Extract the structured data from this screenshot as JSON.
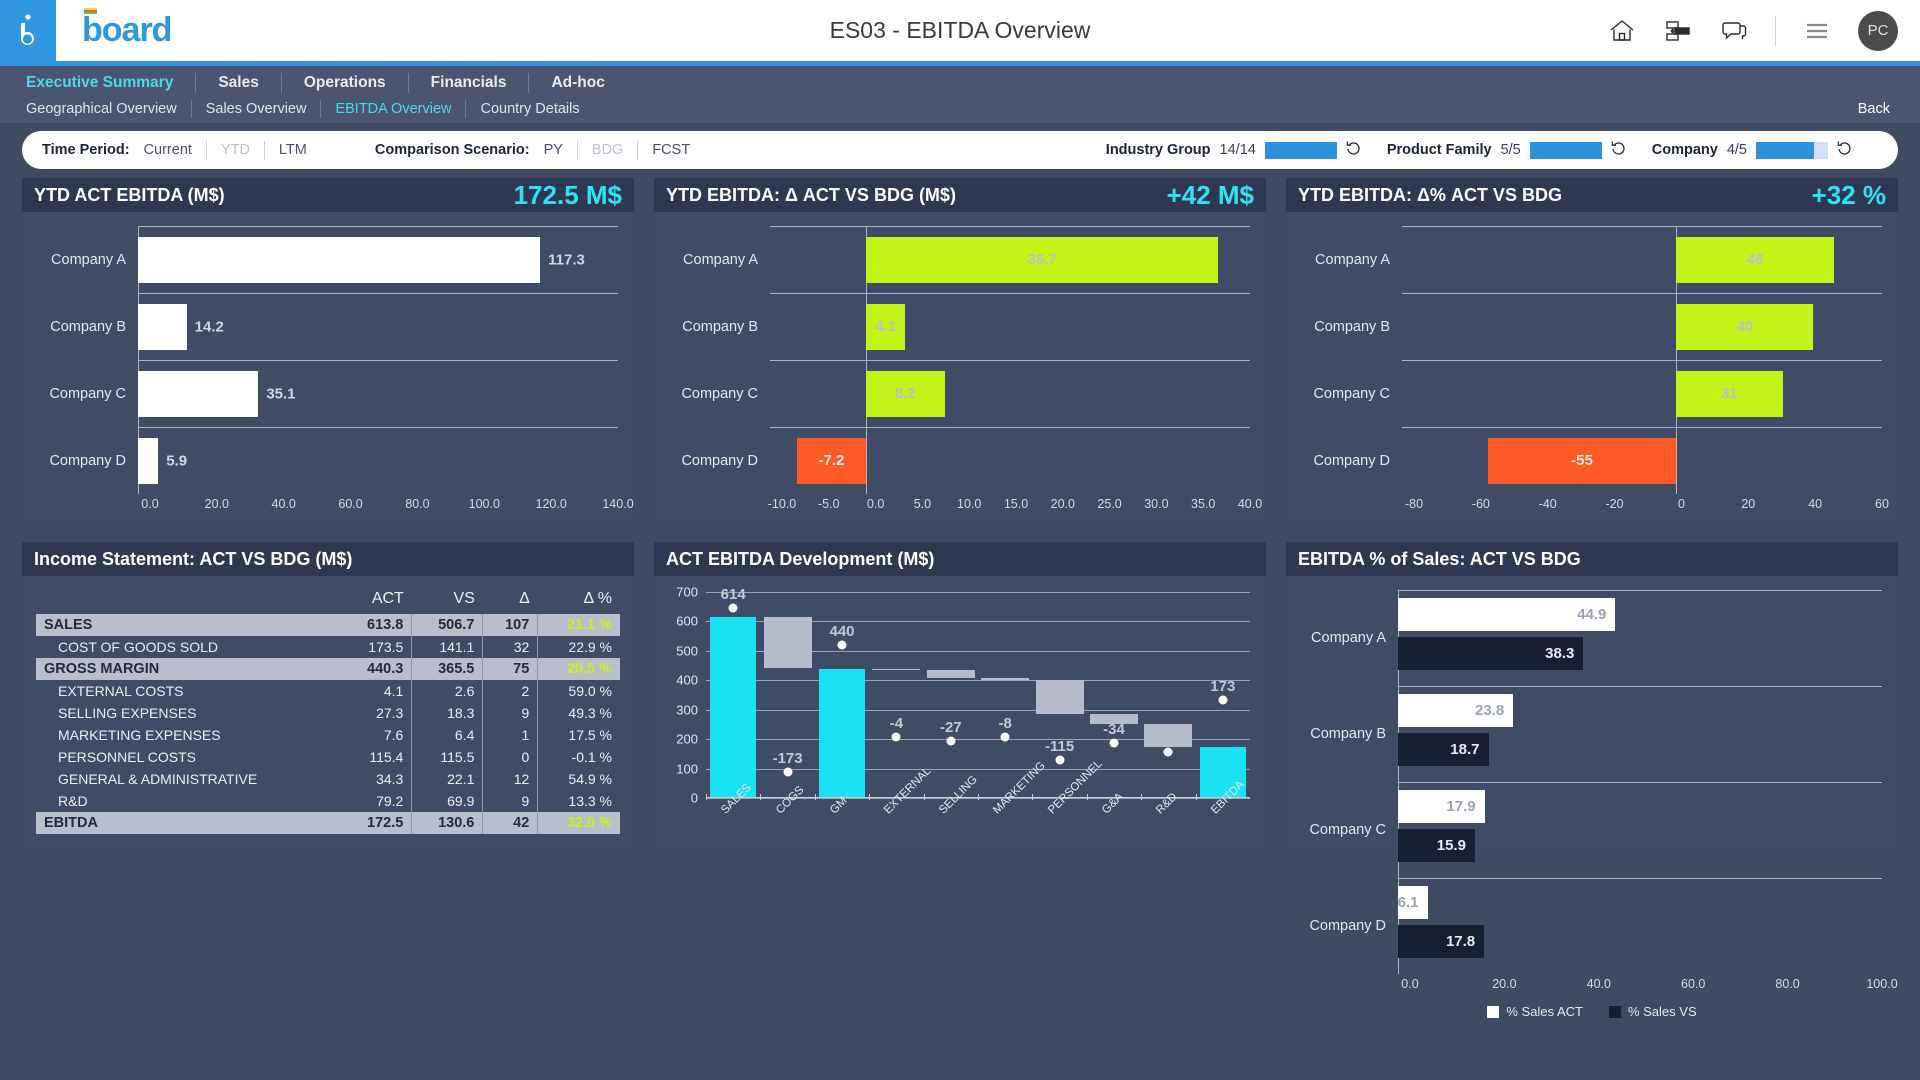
{
  "header": {
    "title": "ES03 - EBITDA Overview",
    "logo_text": "board",
    "icons": [
      "home-icon",
      "layout-icon",
      "chat-icon",
      "hamburger-icon"
    ],
    "avatar_initials": "PC"
  },
  "nav": {
    "level1": [
      {
        "label": "Executive Summary",
        "active": true
      },
      {
        "label": "Sales",
        "active": false
      },
      {
        "label": "Operations",
        "active": false
      },
      {
        "label": "Financials",
        "active": false
      },
      {
        "label": "Ad-hoc",
        "active": false
      }
    ],
    "level2": [
      {
        "label": "Geographical Overview",
        "active": false
      },
      {
        "label": "Sales Overview",
        "active": false
      },
      {
        "label": "EBITDA Overview",
        "active": true
      },
      {
        "label": "Country Details",
        "active": false
      }
    ],
    "back_label": "Back"
  },
  "filters": {
    "time_period_label": "Time Period:",
    "time_period_options": [
      {
        "label": "Current",
        "selected": true
      },
      {
        "label": "YTD",
        "selected": false
      },
      {
        "label": "LTM",
        "selected": true
      }
    ],
    "comparison_label": "Comparison Scenario:",
    "comparison_options": [
      {
        "label": "PY",
        "selected": true
      },
      {
        "label": "BDG",
        "selected": false
      },
      {
        "label": "FCST",
        "selected": true
      }
    ],
    "selectors": [
      {
        "name": "Industry Group",
        "count": "14/14",
        "fill_pct": 100
      },
      {
        "name": "Product Family",
        "count": "5/5",
        "fill_pct": 100
      },
      {
        "name": "Company",
        "count": "4/5",
        "fill_pct": 80
      }
    ]
  },
  "chart_data": [
    {
      "id": "ytd_act_ebitda",
      "type": "bar",
      "orientation": "horizontal",
      "title": "YTD ACT EBITDA (M$)",
      "kpi": "172.5 M$",
      "categories": [
        "Company A",
        "Company B",
        "Company C",
        "Company D"
      ],
      "values": [
        117.3,
        14.2,
        35.1,
        5.9
      ],
      "labels": [
        "117.3",
        "14.2",
        "35.1",
        "5.9"
      ],
      "bar_color": "#ffffff",
      "xlim": [
        0,
        140
      ],
      "ticks": [
        "0.0",
        "20.0",
        "40.0",
        "60.0",
        "80.0",
        "100.0",
        "120.0",
        "140.0"
      ],
      "tick_values": [
        0,
        20,
        40,
        60,
        80,
        100,
        120,
        140
      ],
      "grid": true
    },
    {
      "id": "ytd_ebitda_delta_act_vs_bdg",
      "type": "bar",
      "orientation": "horizontal",
      "title": "YTD EBITDA: Δ ACT VS BDG (M$)",
      "kpi": "+42 M$",
      "categories": [
        "Company A",
        "Company B",
        "Company C",
        "Company D"
      ],
      "values": [
        36.7,
        4.1,
        8.2,
        -7.2
      ],
      "labels": [
        "36.7",
        "4.1",
        "8.2",
        "-7.2"
      ],
      "pos_color": "#c4f318",
      "neg_color": "#fd5a28",
      "xlim": [
        -10,
        40
      ],
      "ticks": [
        "-10.0",
        "-5.0",
        "0.0",
        "5.0",
        "10.0",
        "15.0",
        "20.0",
        "25.0",
        "30.0",
        "35.0",
        "40.0"
      ],
      "tick_values": [
        -10,
        -5,
        0,
        5,
        10,
        15,
        20,
        25,
        30,
        35,
        40
      ],
      "grid": true
    },
    {
      "id": "ytd_ebitda_delta_pct_act_vs_bdg",
      "type": "bar",
      "orientation": "horizontal",
      "title": "YTD EBITDA: Δ% ACT VS BDG",
      "kpi": "+32 %",
      "categories": [
        "Company A",
        "Company B",
        "Company C",
        "Company D"
      ],
      "values": [
        46,
        40,
        31,
        -55
      ],
      "labels": [
        "46",
        "40",
        "31",
        "-55"
      ],
      "pos_color": "#c4f318",
      "neg_color": "#fd5a28",
      "xlim": [
        -80,
        60
      ],
      "ticks": [
        "-80",
        "-60",
        "-40",
        "-20",
        "0",
        "20",
        "40",
        "60"
      ],
      "tick_values": [
        -80,
        -60,
        -40,
        -20,
        0,
        20,
        40,
        60
      ],
      "grid": true
    },
    {
      "id": "act_ebitda_development",
      "type": "bar",
      "subtype": "waterfall",
      "title": "ACT EBITDA Development (M$)",
      "categories": [
        "SALES",
        "COGS",
        "GM",
        "EXTERNAL",
        "SELLING",
        "MARKETING",
        "PERSONNEL",
        "G&A",
        "R&D",
        "EBITDA"
      ],
      "values": [
        614,
        -173,
        440,
        -4,
        -27,
        -8,
        -115,
        -34,
        -79,
        173
      ],
      "labels": [
        "614",
        "-173",
        "440",
        "-4",
        "-27",
        "-8",
        "-115",
        "-34",
        "",
        "173"
      ],
      "cumulative_start": [
        0,
        441,
        0,
        436,
        409,
        401,
        286,
        252,
        173,
        0
      ],
      "cumulative_end": [
        614,
        614,
        440,
        440,
        436,
        409,
        401,
        286,
        252,
        173
      ],
      "total_bars": [
        0,
        2,
        9
      ],
      "ylim": [
        0,
        700
      ],
      "yticks": [
        0,
        100,
        200,
        300,
        400,
        500,
        600,
        700
      ],
      "ytick_labels": [
        "0",
        "100",
        "200",
        "300",
        "400",
        "500",
        "600",
        "700"
      ],
      "total_color": "#19e2f5",
      "delta_color": "#b6bccb",
      "marker_color": "#ffffff",
      "grid": true
    },
    {
      "id": "ebitda_pct_of_sales",
      "type": "bar",
      "orientation": "horizontal",
      "title": "EBITDA % of Sales: ACT VS BDG",
      "categories": [
        "Company A",
        "Company B",
        "Company C",
        "Company D"
      ],
      "series": [
        {
          "name": "% Sales ACT",
          "values": [
            44.9,
            23.8,
            17.9,
            6.1
          ],
          "labels": [
            "44.9",
            "23.8",
            "17.9",
            "6.1"
          ],
          "color": "#ffffff"
        },
        {
          "name": "% Sales VS",
          "values": [
            38.3,
            18.7,
            15.9,
            17.8
          ],
          "labels": [
            "38.3",
            "18.7",
            "15.9",
            "17.8"
          ],
          "color": "#171f33"
        }
      ],
      "xlim": [
        0,
        100
      ],
      "ticks": [
        "0.0",
        "20.0",
        "40.0",
        "60.0",
        "80.0",
        "100.0"
      ],
      "tick_values": [
        0,
        20,
        40,
        60,
        80,
        100
      ],
      "grid": true,
      "legend_position": "bottom"
    },
    {
      "id": "income_statement",
      "type": "table",
      "title": "Income Statement: ACT VS BDG (M$)",
      "columns": [
        "",
        "ACT",
        "VS",
        "Δ",
        "Δ %"
      ],
      "rows": [
        {
          "label": "SALES",
          "act": "613.8",
          "vs": "506.7",
          "delta": "107",
          "delta_pct": "21.1 %",
          "style": "highlight",
          "pct_sign": "pos"
        },
        {
          "label": "COST OF GOODS SOLD",
          "act": "173.5",
          "vs": "141.1",
          "delta": "32",
          "delta_pct": "22.9 %",
          "style": "sub",
          "pct_sign": "neg"
        },
        {
          "label": "GROSS MARGIN",
          "act": "440.3",
          "vs": "365.5",
          "delta": "75",
          "delta_pct": "20.5 %",
          "style": "highlight",
          "pct_sign": "pos"
        },
        {
          "label": "EXTERNAL COSTS",
          "act": "4.1",
          "vs": "2.6",
          "delta": "2",
          "delta_pct": "59.0 %",
          "style": "sub",
          "pct_sign": "neg"
        },
        {
          "label": "SELLING EXPENSES",
          "act": "27.3",
          "vs": "18.3",
          "delta": "9",
          "delta_pct": "49.3 %",
          "style": "sub",
          "pct_sign": "neg"
        },
        {
          "label": "MARKETING EXPENSES",
          "act": "7.6",
          "vs": "6.4",
          "delta": "1",
          "delta_pct": "17.5 %",
          "style": "sub",
          "pct_sign": "neg"
        },
        {
          "label": "PERSONNEL COSTS",
          "act": "115.4",
          "vs": "115.5",
          "delta": "0",
          "delta_pct": "-0.1 %",
          "style": "sub",
          "pct_sign": "pos"
        },
        {
          "label": "GENERAL & ADMINISTRATIVE",
          "act": "34.3",
          "vs": "22.1",
          "delta": "12",
          "delta_pct": "54.9 %",
          "style": "sub",
          "pct_sign": "neg"
        },
        {
          "label": "R&D",
          "act": "79.2",
          "vs": "69.9",
          "delta": "9",
          "delta_pct": "13.3 %",
          "style": "sub",
          "pct_sign": "neg"
        },
        {
          "label": "EBITDA",
          "act": "172.5",
          "vs": "130.6",
          "delta": "42",
          "delta_pct": "32.0 %",
          "style": "highlight",
          "pct_sign": "pos"
        }
      ]
    }
  ]
}
